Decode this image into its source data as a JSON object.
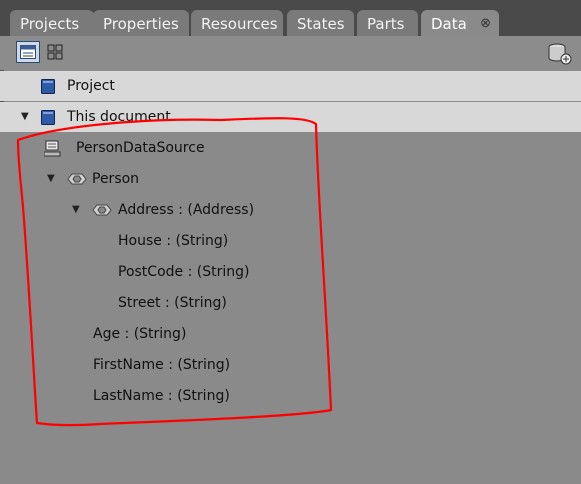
{
  "tabs": [
    {
      "label": "Projects"
    },
    {
      "label": "Properties"
    },
    {
      "label": "Resources"
    },
    {
      "label": "States"
    },
    {
      "label": "Parts"
    },
    {
      "label": "Data",
      "active": true,
      "close": "⊗"
    }
  ],
  "tree": {
    "project": {
      "label": "Project"
    },
    "this_document": {
      "label": "This document"
    },
    "data_source": {
      "label": "PersonDataSource"
    },
    "person": {
      "label": "Person"
    },
    "address": {
      "label": "Address : (Address)"
    },
    "house": {
      "label": "House : (String)"
    },
    "postcode": {
      "label": "PostCode : (String)"
    },
    "street": {
      "label": "Street : (String)"
    },
    "age": {
      "label": "Age : (String)"
    },
    "firstname": {
      "label": "FirstName : (String)"
    },
    "lastname": {
      "label": "LastName : (String)"
    }
  },
  "icons": {
    "list_view": "list-view-icon",
    "tree_view": "tree-view-icon",
    "add_data_source": "database-add-icon"
  },
  "colors": {
    "annotation": "#ff0000",
    "selected_row": "#d8d8d8",
    "background": "#8a8a8a"
  }
}
